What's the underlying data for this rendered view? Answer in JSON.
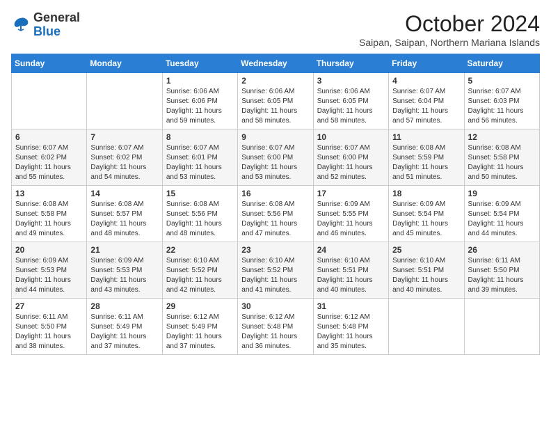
{
  "logo": {
    "general": "General",
    "blue": "Blue"
  },
  "header": {
    "month": "October 2024",
    "subtitle": "Saipan, Saipan, Northern Mariana Islands"
  },
  "days_of_week": [
    "Sunday",
    "Monday",
    "Tuesday",
    "Wednesday",
    "Thursday",
    "Friday",
    "Saturday"
  ],
  "weeks": [
    [
      {
        "day": "",
        "content": ""
      },
      {
        "day": "",
        "content": ""
      },
      {
        "day": "1",
        "content": "Sunrise: 6:06 AM\nSunset: 6:06 PM\nDaylight: 11 hours and 59 minutes."
      },
      {
        "day": "2",
        "content": "Sunrise: 6:06 AM\nSunset: 6:05 PM\nDaylight: 11 hours and 58 minutes."
      },
      {
        "day": "3",
        "content": "Sunrise: 6:06 AM\nSunset: 6:05 PM\nDaylight: 11 hours and 58 minutes."
      },
      {
        "day": "4",
        "content": "Sunrise: 6:07 AM\nSunset: 6:04 PM\nDaylight: 11 hours and 57 minutes."
      },
      {
        "day": "5",
        "content": "Sunrise: 6:07 AM\nSunset: 6:03 PM\nDaylight: 11 hours and 56 minutes."
      }
    ],
    [
      {
        "day": "6",
        "content": "Sunrise: 6:07 AM\nSunset: 6:02 PM\nDaylight: 11 hours and 55 minutes."
      },
      {
        "day": "7",
        "content": "Sunrise: 6:07 AM\nSunset: 6:02 PM\nDaylight: 11 hours and 54 minutes."
      },
      {
        "day": "8",
        "content": "Sunrise: 6:07 AM\nSunset: 6:01 PM\nDaylight: 11 hours and 53 minutes."
      },
      {
        "day": "9",
        "content": "Sunrise: 6:07 AM\nSunset: 6:00 PM\nDaylight: 11 hours and 53 minutes."
      },
      {
        "day": "10",
        "content": "Sunrise: 6:07 AM\nSunset: 6:00 PM\nDaylight: 11 hours and 52 minutes."
      },
      {
        "day": "11",
        "content": "Sunrise: 6:08 AM\nSunset: 5:59 PM\nDaylight: 11 hours and 51 minutes."
      },
      {
        "day": "12",
        "content": "Sunrise: 6:08 AM\nSunset: 5:58 PM\nDaylight: 11 hours and 50 minutes."
      }
    ],
    [
      {
        "day": "13",
        "content": "Sunrise: 6:08 AM\nSunset: 5:58 PM\nDaylight: 11 hours and 49 minutes."
      },
      {
        "day": "14",
        "content": "Sunrise: 6:08 AM\nSunset: 5:57 PM\nDaylight: 11 hours and 48 minutes."
      },
      {
        "day": "15",
        "content": "Sunrise: 6:08 AM\nSunset: 5:56 PM\nDaylight: 11 hours and 48 minutes."
      },
      {
        "day": "16",
        "content": "Sunrise: 6:08 AM\nSunset: 5:56 PM\nDaylight: 11 hours and 47 minutes."
      },
      {
        "day": "17",
        "content": "Sunrise: 6:09 AM\nSunset: 5:55 PM\nDaylight: 11 hours and 46 minutes."
      },
      {
        "day": "18",
        "content": "Sunrise: 6:09 AM\nSunset: 5:54 PM\nDaylight: 11 hours and 45 minutes."
      },
      {
        "day": "19",
        "content": "Sunrise: 6:09 AM\nSunset: 5:54 PM\nDaylight: 11 hours and 44 minutes."
      }
    ],
    [
      {
        "day": "20",
        "content": "Sunrise: 6:09 AM\nSunset: 5:53 PM\nDaylight: 11 hours and 44 minutes."
      },
      {
        "day": "21",
        "content": "Sunrise: 6:09 AM\nSunset: 5:53 PM\nDaylight: 11 hours and 43 minutes."
      },
      {
        "day": "22",
        "content": "Sunrise: 6:10 AM\nSunset: 5:52 PM\nDaylight: 11 hours and 42 minutes."
      },
      {
        "day": "23",
        "content": "Sunrise: 6:10 AM\nSunset: 5:52 PM\nDaylight: 11 hours and 41 minutes."
      },
      {
        "day": "24",
        "content": "Sunrise: 6:10 AM\nSunset: 5:51 PM\nDaylight: 11 hours and 40 minutes."
      },
      {
        "day": "25",
        "content": "Sunrise: 6:10 AM\nSunset: 5:51 PM\nDaylight: 11 hours and 40 minutes."
      },
      {
        "day": "26",
        "content": "Sunrise: 6:11 AM\nSunset: 5:50 PM\nDaylight: 11 hours and 39 minutes."
      }
    ],
    [
      {
        "day": "27",
        "content": "Sunrise: 6:11 AM\nSunset: 5:50 PM\nDaylight: 11 hours and 38 minutes."
      },
      {
        "day": "28",
        "content": "Sunrise: 6:11 AM\nSunset: 5:49 PM\nDaylight: 11 hours and 37 minutes."
      },
      {
        "day": "29",
        "content": "Sunrise: 6:12 AM\nSunset: 5:49 PM\nDaylight: 11 hours and 37 minutes."
      },
      {
        "day": "30",
        "content": "Sunrise: 6:12 AM\nSunset: 5:48 PM\nDaylight: 11 hours and 36 minutes."
      },
      {
        "day": "31",
        "content": "Sunrise: 6:12 AM\nSunset: 5:48 PM\nDaylight: 11 hours and 35 minutes."
      },
      {
        "day": "",
        "content": ""
      },
      {
        "day": "",
        "content": ""
      }
    ]
  ]
}
